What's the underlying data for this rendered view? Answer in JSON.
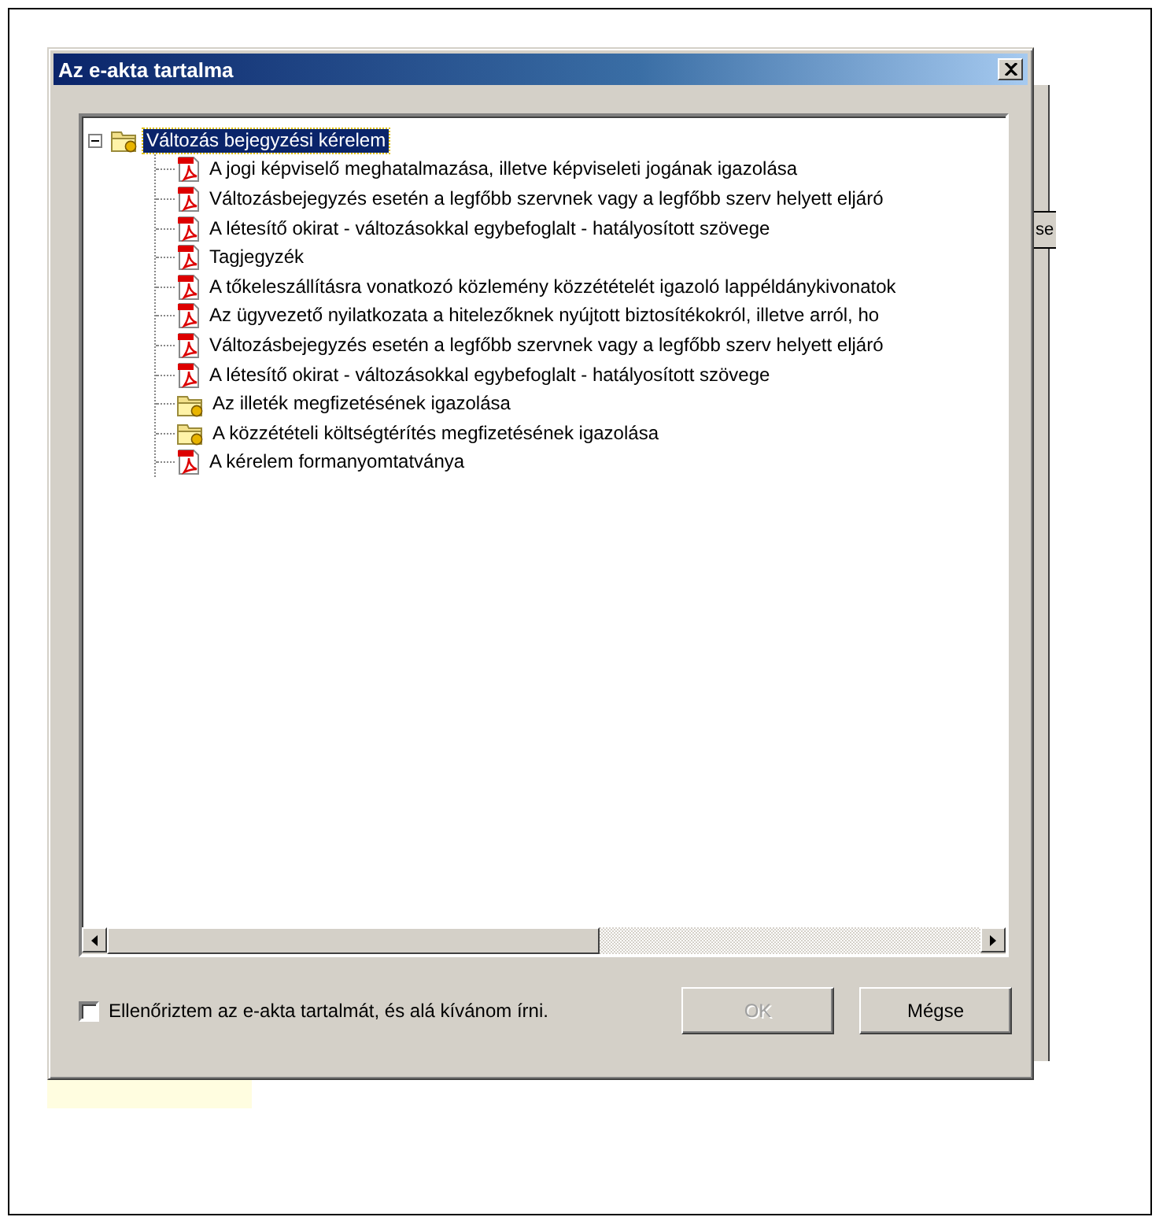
{
  "window": {
    "title": "Az e-akta tartalma"
  },
  "background_window": {
    "button_text": "se"
  },
  "tree": {
    "label": "Változás bejegyzési kérelem",
    "kind": "folder",
    "expanded": true,
    "selected": true,
    "children": [
      {
        "label": "A jogi képviselő meghatalmazása, illetve képviseleti jogának igazolása",
        "kind": "pdf"
      },
      {
        "label": "Változásbejegyzés esetén a legfőbb szervnek vagy a legfőbb szerv helyett eljáró",
        "kind": "pdf"
      },
      {
        "label": "A létesítő okirat - változásokkal egybefoglalt - hatályosított szövege",
        "kind": "pdf"
      },
      {
        "label": "Tagjegyzék",
        "kind": "pdf"
      },
      {
        "label": "A tőkeleszállításra vonatkozó közlemény közzétételét igazoló lappéldánykivonatok",
        "kind": "pdf"
      },
      {
        "label": "Az ügyvezető nyilatkozata a hitelezőknek nyújtott biztosítékokról, illetve arról, ho",
        "kind": "pdf"
      },
      {
        "label": "Változásbejegyzés esetén a legfőbb szervnek vagy a legfőbb szerv helyett eljáró",
        "kind": "pdf"
      },
      {
        "label": "A létesítő okirat - változásokkal egybefoglalt - hatályosított szövege",
        "kind": "pdf"
      },
      {
        "label": "Az illeték megfizetésének igazolása",
        "kind": "folder"
      },
      {
        "label": "A közzétételi költségtérítés megfizetésének igazolása",
        "kind": "folder"
      },
      {
        "label": "A kérelem formanyomtatványa",
        "kind": "pdf"
      }
    ]
  },
  "confirm": {
    "label": "Ellenőriztem az e-akta tartalmát, és alá kívánom írni.",
    "checked": false
  },
  "buttons": [
    {
      "label": "OK",
      "disabled": true
    },
    {
      "label": "Mégse",
      "disabled": false
    }
  ]
}
